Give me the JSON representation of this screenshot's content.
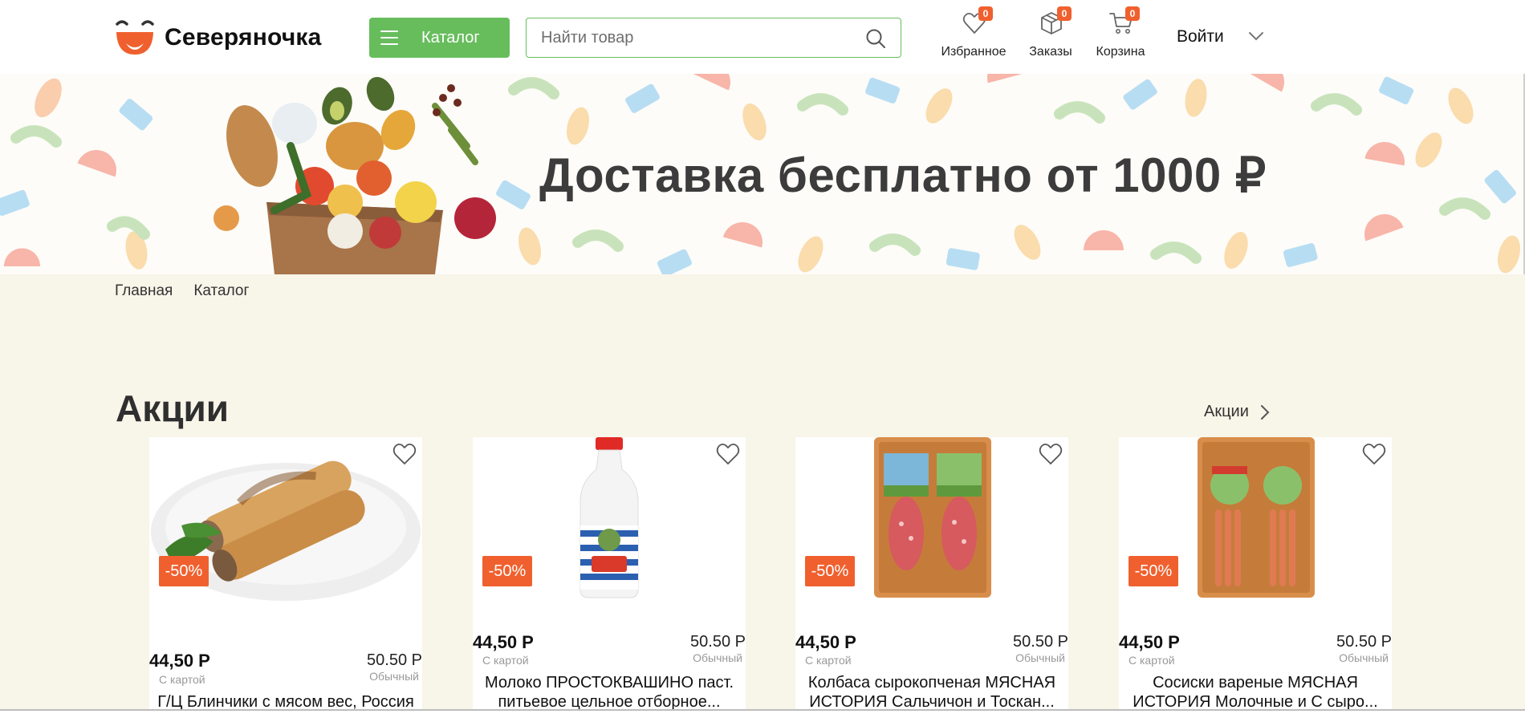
{
  "header": {
    "logo_text": "Северяночка",
    "catalog_label": "Каталог",
    "search_placeholder": "Найти товар",
    "favorites": {
      "label": "Избранное",
      "count": "0"
    },
    "orders": {
      "label": "Заказы",
      "count": "0"
    },
    "cart": {
      "label": "Корзина",
      "count": "0"
    },
    "login_label": "Войти"
  },
  "banner": {
    "text": "Доставка бесплатно от 1000 ₽"
  },
  "breadcrumb": [
    "Главная",
    "Каталог"
  ],
  "promos": {
    "title": "Акции",
    "link_label": "Акции",
    "cards": [
      {
        "discount": "-50%",
        "price_card": "44,50 Р",
        "price_card_label": "С картой",
        "price_regular": "50.50 Р",
        "price_regular_label": "Обычный",
        "title": "Г/Ц Блинчики с мясом вес, Россия"
      },
      {
        "discount": "-50%",
        "price_card": "44,50 Р",
        "price_card_label": "С картой",
        "price_regular": "50.50 Р",
        "price_regular_label": "Обычный",
        "title": "Молоко ПРОСТОКВАШИНО паст. питьевое цельное отборное..."
      },
      {
        "discount": "-50%",
        "price_card": "44,50 Р",
        "price_card_label": "С картой",
        "price_regular": "50.50 Р",
        "price_regular_label": "Обычный",
        "title": "Колбаса сырокопченая МЯСНАЯ ИСТОРИЯ Сальчичон и Тоскан..."
      },
      {
        "discount": "-50%",
        "price_card": "44,50 Р",
        "price_card_label": "С картой",
        "price_regular": "50.50 Р",
        "price_regular_label": "Обычный",
        "title": "Сосиски вареные МЯСНАЯ ИСТОРИЯ Молочные и С сыро..."
      }
    ]
  },
  "colors": {
    "accent_green": "#67bd5c",
    "accent_orange": "#f0602e",
    "content_bg": "#f8f5e9"
  }
}
